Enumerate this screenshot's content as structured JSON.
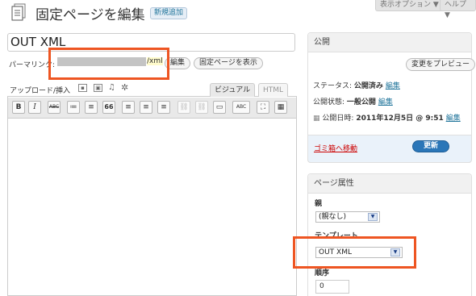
{
  "header": {
    "screen_options": "表示オプション ▼",
    "help": "ヘルプ ▼",
    "title": "固定ページを編集",
    "new_button": "新規追加"
  },
  "post": {
    "title": "OUT XML",
    "permalink_label": "パーマリンク:",
    "permalink_tail": "/xml",
    "edit_button": "編集",
    "view_button": "固定ページを表示"
  },
  "editor": {
    "upload_label": "アップロード/挿入",
    "tab_visual": "ビジュアル",
    "tab_html": "HTML"
  },
  "toolbar": [
    "B",
    "I",
    "ABC",
    "≔",
    "≡",
    "66",
    "≡",
    "≡",
    "≡",
    "⛓",
    "⛓",
    "▭",
    "ABC",
    "⛶",
    "▦"
  ],
  "publish": {
    "heading": "公開",
    "preview_button": "変更をプレビュー",
    "status_label": "ステータス:",
    "status_value": "公開済み",
    "visibility_label": "公開状態:",
    "visibility_value": "一般公開",
    "date_label": "公開日時:",
    "date_value": "2011年12月5日 @ 9:51",
    "edit_link": "編集",
    "trash_link": "ゴミ箱へ移動",
    "update_button": "更新"
  },
  "attributes": {
    "heading": "ページ属性",
    "parent_label": "親",
    "parent_value": "(親なし)",
    "template_label": "テンプレート",
    "template_value": "OUT XML",
    "order_label": "順序",
    "order_value": "0"
  },
  "colors": {
    "accent": "#21759b",
    "highlight": "#ee5522",
    "update_button": "#2a76b8"
  }
}
